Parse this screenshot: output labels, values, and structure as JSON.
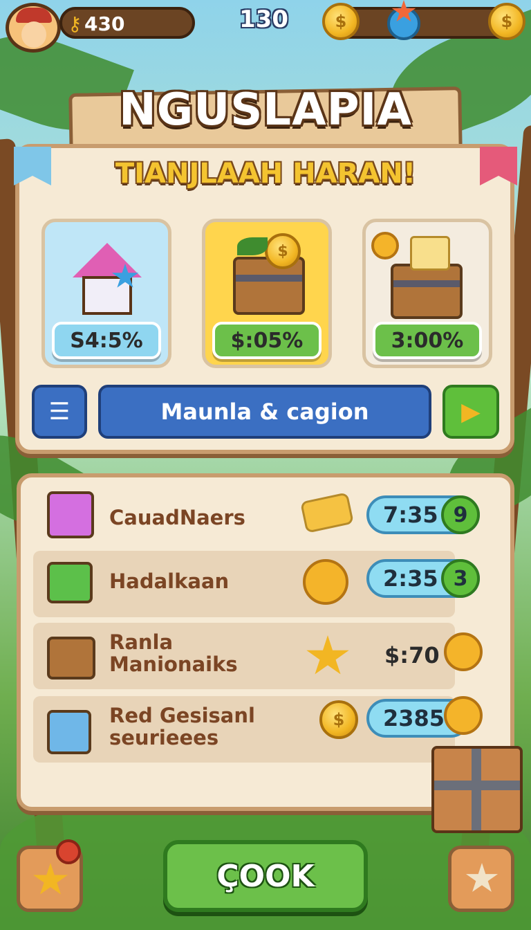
{
  "hud": {
    "keys_value": "430",
    "center_value": "130"
  },
  "banner": {
    "title": "NGUSLAPIA",
    "subtitle": "TIANJLAAH HARAN!"
  },
  "offers": [
    {
      "price": "S4:5%",
      "icon": "house-icon",
      "bg": "#bfe6f7",
      "price_bg": "#8fd6f0"
    },
    {
      "price": "$:05%",
      "icon": "chest-icon",
      "bg": "#ffd54d",
      "price_bg": "#6cc04a"
    },
    {
      "price": "3:00%",
      "icon": "treasure-chest-icon",
      "bg": "#f4ecdf",
      "price_bg": "#6cc04a"
    }
  ],
  "action_bar": {
    "label": "Maunla & cagion"
  },
  "list": [
    {
      "label": "CauadNaers",
      "icon": "cube-icon",
      "reward_icon": "gold-piece-icon",
      "value": "7:35",
      "badge": "9"
    },
    {
      "label": "Hadalkaan",
      "icon": "cash-box-icon",
      "reward_icon": "sun-face-icon",
      "value": "2:35",
      "badge": "3"
    },
    {
      "label": "Ranla Manionaiks",
      "icon": "chest-icon",
      "reward_icon": "star-icon",
      "value": "$:70",
      "badge": ""
    },
    {
      "label": "Red Gesisanl seurieees",
      "icon": "blue-box-icon",
      "reward_icon": "coin-star-icon",
      "value": "2385",
      "badge": ""
    }
  ],
  "bottom": {
    "main_button": "ÇOOK"
  },
  "colors": {
    "panel": "#f6ead5",
    "border": "#c89c6e",
    "green": "#6cc04a",
    "blue": "#3b6fc2",
    "gold": "#f2b623"
  }
}
